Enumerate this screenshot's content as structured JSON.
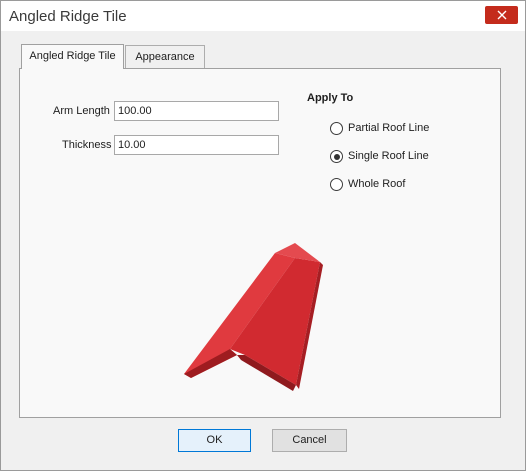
{
  "window": {
    "title": "Angled Ridge Tile"
  },
  "tabs": [
    {
      "label": "Angled Ridge Tile",
      "active": true
    },
    {
      "label": "Appearance",
      "active": false
    }
  ],
  "fields": {
    "arm_length": {
      "label": "Arm Length",
      "value": "100.00"
    },
    "thickness": {
      "label": "Thickness",
      "value": "10.00"
    }
  },
  "apply_to": {
    "title": "Apply To",
    "options": [
      {
        "label": "Partial Roof Line",
        "selected": false
      },
      {
        "label": "Single Roof Line",
        "selected": true
      },
      {
        "label": "Whole Roof",
        "selected": false
      }
    ]
  },
  "preview": {
    "color": "#d9272e"
  },
  "buttons": {
    "ok": "OK",
    "cancel": "Cancel"
  }
}
